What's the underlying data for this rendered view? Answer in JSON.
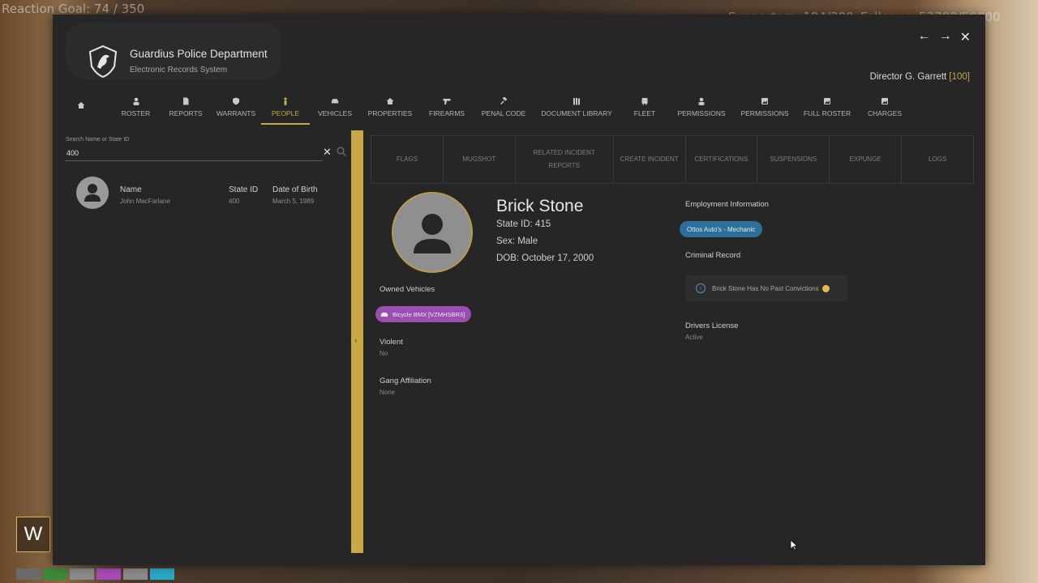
{
  "overlay": {
    "reaction_goal": "Reaction Goal: 74 / 350",
    "supporters": "Supporters: 194/300",
    "follower": "Follower: 53792/50000",
    "hud_letter": "W"
  },
  "app": {
    "title": "Guardius Police Department",
    "subtitle": "Electronic Records System",
    "user_name": "Director G. Garrett",
    "user_rank": "[100]"
  },
  "window_controls": {
    "back": "←",
    "forward": "→",
    "close": "✕"
  },
  "nav": [
    {
      "label": "",
      "icon": "home-icon"
    },
    {
      "label": "ROSTER",
      "icon": "person-icon"
    },
    {
      "label": "REPORTS",
      "icon": "file-icon"
    },
    {
      "label": "WARRANTS",
      "icon": "badge-icon"
    },
    {
      "label": "PEOPLE",
      "icon": "person-icon"
    },
    {
      "label": "VEHICLES",
      "icon": "car-icon"
    },
    {
      "label": "PROPERTIES",
      "icon": "house-icon"
    },
    {
      "label": "FIREARMS",
      "icon": "gun-icon"
    },
    {
      "label": "PENAL CODE",
      "icon": "gavel-icon"
    },
    {
      "label": "DOCUMENT LIBRARY",
      "icon": "books-icon"
    },
    {
      "label": "FLEET",
      "icon": "car-icon"
    },
    {
      "label": "PERMISSIONS",
      "icon": "person-icon"
    },
    {
      "label": "PERMISSIONS",
      "icon": "image-icon"
    },
    {
      "label": "FULL ROSTER",
      "icon": "image-icon"
    },
    {
      "label": "CHARGES",
      "icon": "image-icon"
    }
  ],
  "search": {
    "label": "Search Name or State ID",
    "value": "400"
  },
  "results": [
    {
      "name_header": "Name",
      "name": "John MacFarlane",
      "id_header": "State ID",
      "state_id": "400",
      "dob_header": "Date of Birth",
      "dob": "March 5, 1989"
    }
  ],
  "tabs": [
    "FLAGS",
    "MUGSHOT",
    "RELATED INCIDENT REPORTS",
    "CREATE INCIDENT",
    "CERTIFICATIONS",
    "SUSPENSIONS",
    "EXPUNGE",
    "LOGS"
  ],
  "profile": {
    "name": "Brick Stone",
    "state_id": "State ID: 415",
    "sex": "Sex: Male",
    "dob": "DOB: October 17, 2000",
    "owned_vehicles_title": "Owned Vehicles",
    "vehicle_chip": "Bicycle BMX [VZMHSBR3]",
    "violent_title": "Violent",
    "violent_value": "No",
    "gang_title": "Gang Affiliation",
    "gang_value": "None",
    "employment_title": "Employment Information",
    "employment_chip": "Ottos Auto's - Mechanic",
    "criminal_title": "Criminal Record",
    "criminal_text": "Brick Stone Has No Past Convictions",
    "license_title": "Drivers License",
    "license_value": "Active"
  },
  "colors": {
    "accent": "#c9a845",
    "vehicle_chip": "#9a4fb0",
    "employment_chip": "#2d6f98",
    "panel": "#262626"
  }
}
